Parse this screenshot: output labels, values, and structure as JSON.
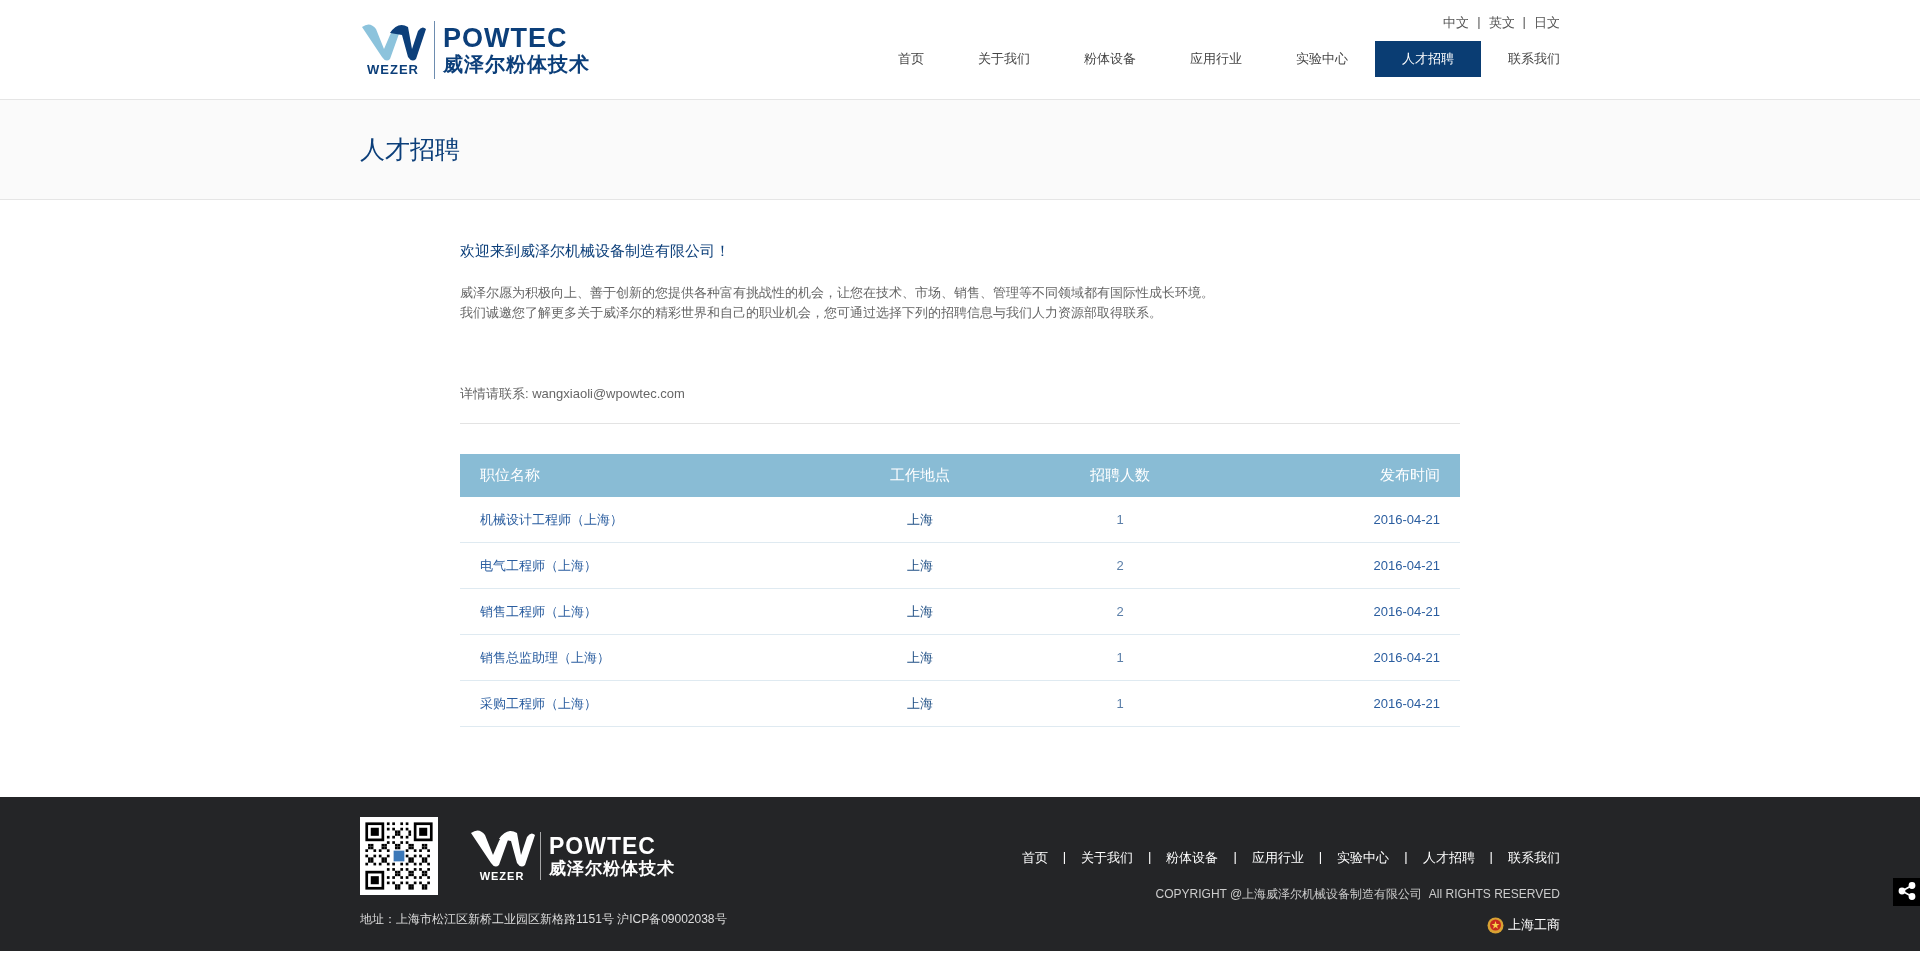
{
  "header": {
    "logo": {
      "mark_text": "WEZER",
      "name": "POWTEC",
      "subtitle": "威泽尔粉体技术"
    },
    "separator": "|",
    "languages": [
      "中文",
      "英文",
      "日文"
    ],
    "nav": [
      {
        "label": "首页",
        "selected": false
      },
      {
        "label": "关于我们",
        "selected": false
      },
      {
        "label": "粉体设备",
        "selected": false
      },
      {
        "label": "应用行业",
        "selected": false
      },
      {
        "label": "实验中心",
        "selected": false
      },
      {
        "label": "人才招聘",
        "selected": true
      },
      {
        "label": "联系我们",
        "selected": false
      }
    ]
  },
  "banner": {
    "title": "人才招聘"
  },
  "intro": {
    "heading": "欢迎来到威泽尔机械设备制造有限公司！",
    "paragraphs": [
      "威泽尔愿为积极向上、善于创新的您提供各种富有挑战性的机会，让您在技术、市场、销售、管理等不同领域都有国际性成长环境。",
      "我们诚邀您了解更多关于威泽尔的精彩世界和自己的职业机会，您可通过选择下列的招聘信息与我们人力资源部取得联系。"
    ],
    "contact": "详情请联系: wangxiaoli@wpowtec.com"
  },
  "table": {
    "columns": [
      "职位名称",
      "工作地点",
      "招聘人数",
      "发布时间"
    ],
    "rows": [
      {
        "title": "机械设计工程师（上海）",
        "location": "上海",
        "openings": "1",
        "date": "2016-04-21"
      },
      {
        "title": "电气工程师（上海）",
        "location": "上海",
        "openings": "2",
        "date": "2016-04-21"
      },
      {
        "title": "销售工程师（上海）",
        "location": "上海",
        "openings": "2",
        "date": "2016-04-21"
      },
      {
        "title": "销售总监助理（上海）",
        "location": "上海",
        "openings": "1",
        "date": "2016-04-21"
      },
      {
        "title": "采购工程师（上海）",
        "location": "上海",
        "openings": "1",
        "date": "2016-04-21"
      }
    ]
  },
  "footer": {
    "logo": {
      "mark_text": "WEZER",
      "name": "POWTEC",
      "subtitle": "威泽尔粉体技术"
    },
    "address": "地址：上海市松江区新桥工业园区新格路1151号 沪ICP备09002038号",
    "separator": "|",
    "nav": [
      "首页",
      "关于我们",
      "粉体设备",
      "应用行业",
      "实验中心",
      "人才招聘",
      "联系我们"
    ],
    "copyright": "COPYRIGHT @上海威泽尔机械设备制造有限公司  All RIGHTS RESERVED",
    "badge": "上海工商"
  }
}
